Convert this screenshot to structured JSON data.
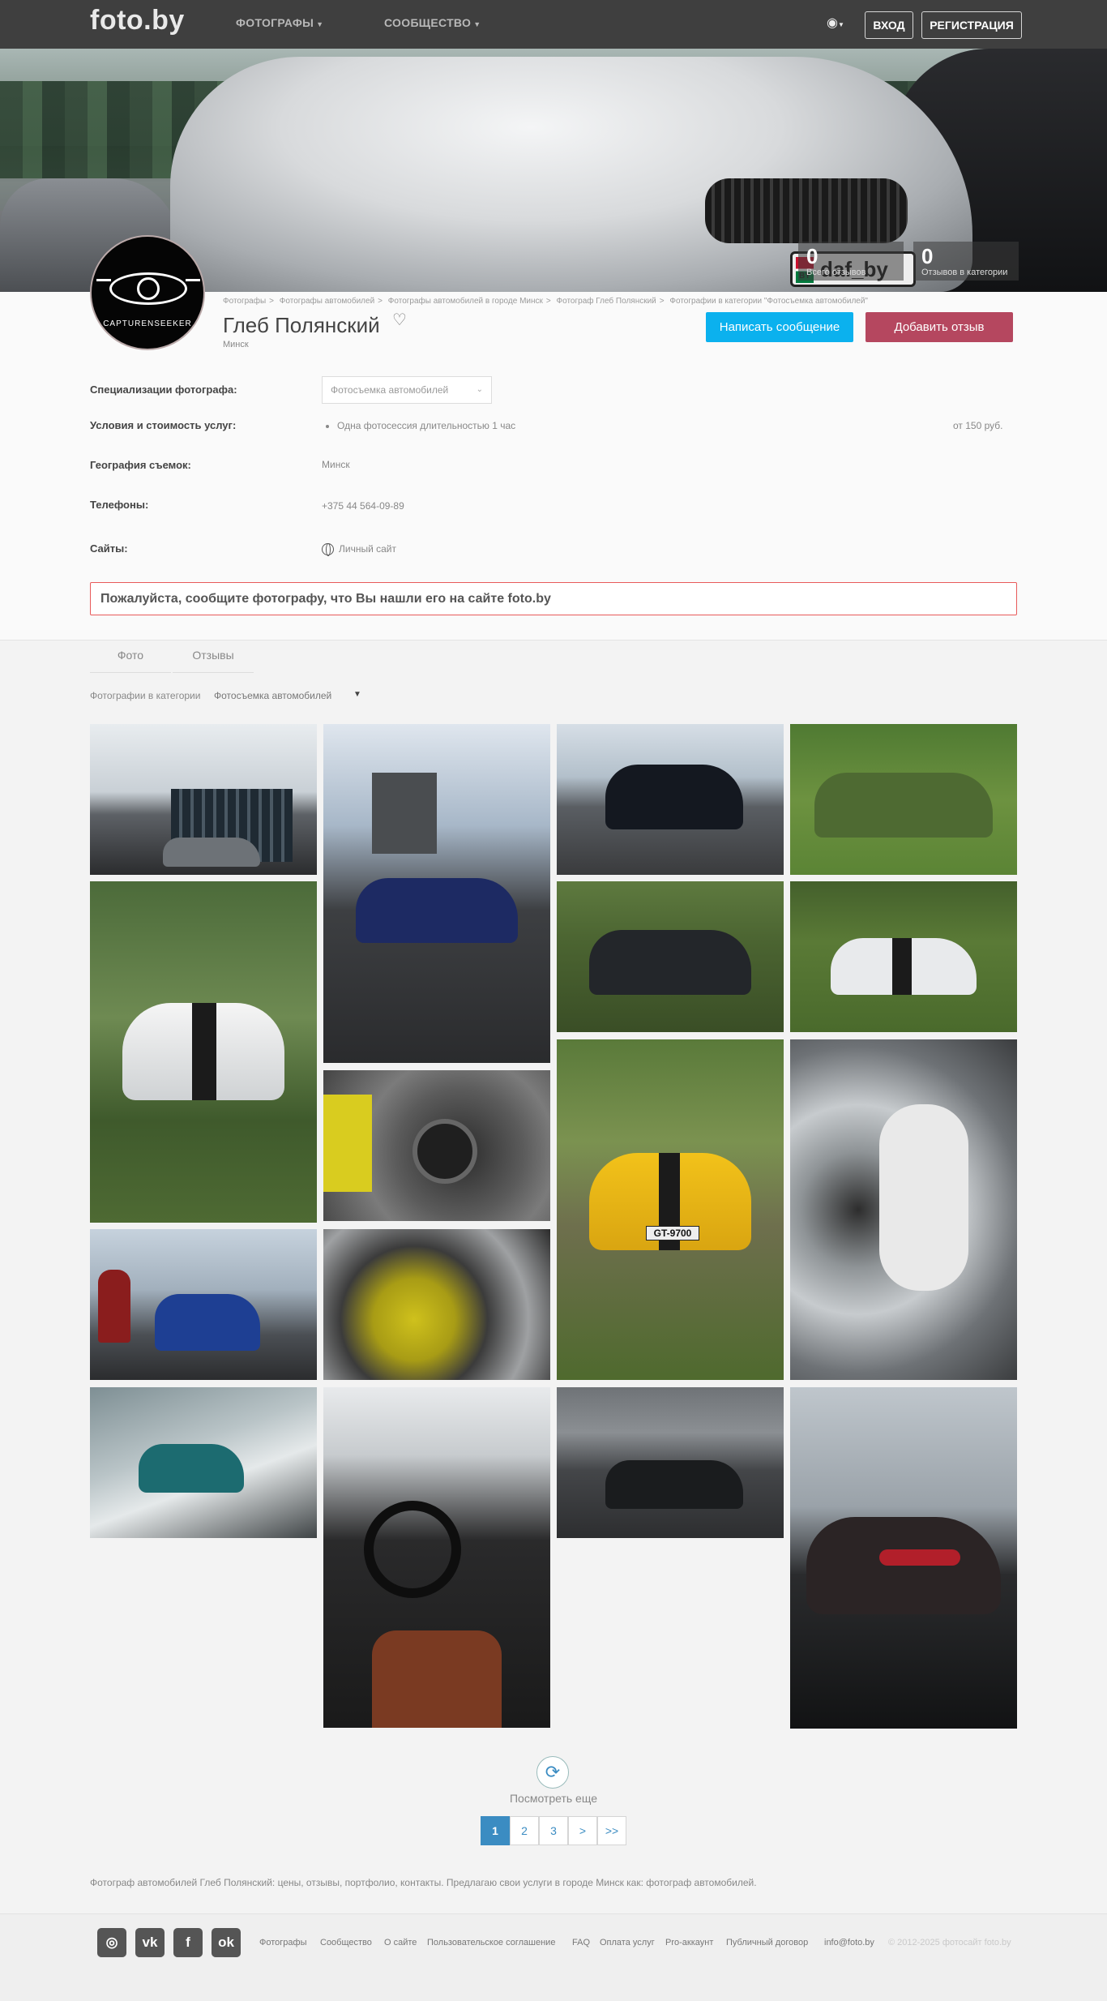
{
  "header": {
    "logo": "foto.by",
    "nav_photographers": "ФОТОГРАФЫ",
    "nav_community": "СООБЩЕСТВО",
    "login": "ВХОД",
    "register": "РЕГИСТРАЦИЯ"
  },
  "cover": {
    "plate_text": "daf_by",
    "plate_country": "BY",
    "stats": [
      {
        "value": "0",
        "label": "Всего отзывов"
      },
      {
        "value": "0",
        "label": "Отзывов в категории"
      }
    ]
  },
  "avatar": {
    "label": "CAPTURENSEEKER"
  },
  "breadcrumb": [
    "Фотографы",
    "Фотографы автомобилей",
    "Фотографы автомобилей в городе Минск",
    "Фотограф Глеб Полянский",
    "Фотографии в категории \"Фотосъемка автомобилей\""
  ],
  "profile": {
    "name": "Глеб Полянский",
    "city": "Минск",
    "write_message": "Написать сообщение",
    "add_review": "Добавить отзыв"
  },
  "details": {
    "spec_label": "Специализации фотографа:",
    "spec_value": "Фотосъемка автомобилей",
    "terms_label": "Условия и стоимость услуг:",
    "terms_item": "Одна фотосессия длительностью 1 час",
    "terms_price": "от 150 руб.",
    "geo_label": "География съемок:",
    "geo_value": "Минск",
    "phones_label": "Телефоны:",
    "phones_value": "+375 44 564-09-89",
    "sites_label": "Сайты:",
    "sites_value": "Личный сайт"
  },
  "notice": "Пожалуйста, сообщите фотографу, что Вы нашли его на сайте foto.by",
  "tabs": {
    "photo": "Фото",
    "reviews": "Отзывы"
  },
  "filter": {
    "label": "Фотографии в категории",
    "value": "Фотосъемка автомобилей"
  },
  "gallery": {
    "plates": [
      "GT-9700"
    ]
  },
  "more": {
    "label": "Посмотреть еще"
  },
  "pagination": [
    "1",
    "2",
    "3",
    ">",
    ">>"
  ],
  "seo_text": "Фотограф автомобилей Глеб Полянский: цены, отзывы, портфолио, контакты. Предлагаю свои услуги в городе Минск как: фотограф автомобилей.",
  "footer": {
    "links": [
      "Фотографы",
      "Сообщество",
      "О сайте",
      "Пользовательское соглашение",
      "FAQ",
      "Оплата услуг",
      "Pro-аккаунт",
      "Публичный договор",
      "info@foto.by"
    ],
    "copyright": "© 2012-2025 фотосайт foto.by",
    "social": [
      "instagram-icon",
      "vk-icon",
      "facebook-icon",
      "odnoklassniki-icon"
    ]
  }
}
